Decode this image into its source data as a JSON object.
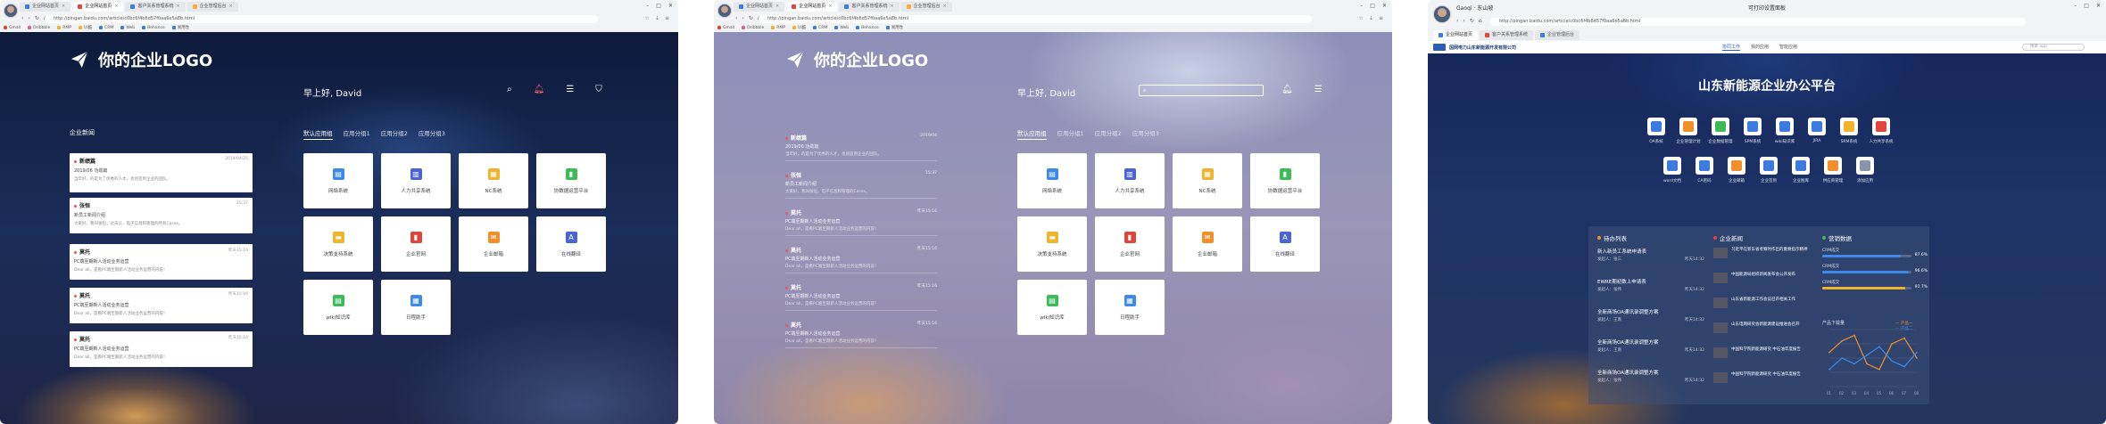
{
  "shot1": {
    "tabs": [
      {
        "label": "企业网站首页",
        "color": "#3d7be0"
      },
      {
        "label": "企业网站首页",
        "color": "#e0453d",
        "active": true
      },
      {
        "label": "客户关系管理系统",
        "color": "#3d7be0"
      },
      {
        "label": "企业管理后台",
        "color": "#f1b32b"
      }
    ],
    "address": "http://pingan.baidu.com/article/c0bc6f4b6d57f0aa6e5a8b.html",
    "bookmarks": [
      {
        "label": "Gmail",
        "color": "#e0453d"
      },
      {
        "label": "Dribbble",
        "color": "#e85d9c"
      },
      {
        "label": "RMP",
        "color": "#f1b32b"
      },
      {
        "label": "UI酷",
        "color": "#f1b32b"
      },
      {
        "label": "CRM",
        "color": "#3d7be0"
      },
      {
        "label": "Web",
        "color": "#3d7be0"
      },
      {
        "label": "Behance",
        "color": "#3d7be0"
      },
      {
        "label": "易用性",
        "color": "#3d7be0"
      }
    ],
    "logo": "你的企业LOGO",
    "greeting": "早上好, David",
    "news_title": "企业新闻",
    "news": [
      {
        "title": "新绩篇",
        "date": "2019/04/25",
        "sub": "2019/06 功勋篇",
        "body": "当年好，的是为了优秀的人才，也创造到企业的团队。"
      },
      {
        "title": "张恒",
        "date": "15:37",
        "sub": "新员工新闻介绍",
        "body": "大家好，我叫张恒，过去认，电子信息和管理的所有Cases。"
      },
      {
        "title": "莫托",
        "date": "昨天15:16",
        "sub": "PC端至期新人活动业务运营",
        "body": "Dear all，是看PC端至期新人活动业务运营的内容！"
      },
      {
        "title": "莫托",
        "date": "昨天15:16",
        "sub": "PC端至期新人活动业务运营",
        "body": "Dear all，是看PC端至期新人活动业务运营的内容！"
      },
      {
        "title": "莫托",
        "date": "昨天15:16",
        "sub": "PC端至期新人活动业务运营",
        "body": "Dear all，是看PC端至期新人活动业务运营的内容！"
      }
    ],
    "app_tabs": [
      "默认应用组",
      "应用分组1",
      "应用分组2",
      "应用分组3"
    ],
    "apps": [
      {
        "label": "网络系统",
        "color": "#3d8ae8",
        "glyph": "▤"
      },
      {
        "label": "人力共享系统",
        "color": "#4a63d6",
        "glyph": "▥"
      },
      {
        "label": "NC系统",
        "color": "#f1b32b",
        "glyph": "▦"
      },
      {
        "label": "协数据运营平台",
        "color": "#3dbb58",
        "glyph": "▮"
      },
      {
        "label": "决策支持系统",
        "color": "#f1b32b",
        "glyph": "▬"
      },
      {
        "label": "企业官网",
        "color": "#e0453d",
        "glyph": "▮"
      },
      {
        "label": "企业邮箱",
        "color": "#f18f2b",
        "glyph": "✉"
      },
      {
        "label": "在线翻译",
        "color": "#4a63d6",
        "glyph": "A"
      },
      {
        "label": "wiki知识库",
        "color": "#3dbb58",
        "glyph": "▤"
      },
      {
        "label": "日程助手",
        "color": "#3d8ae8",
        "glyph": "▦"
      }
    ]
  },
  "shot2": {
    "tabs": [
      {
        "label": "企业网站首页",
        "color": "#3d7be0"
      },
      {
        "label": "企业网站首页",
        "color": "#e0453d",
        "active": true
      },
      {
        "label": "客户关系管理系统",
        "color": "#3d7be0"
      },
      {
        "label": "企业管理后台",
        "color": "#f1b32b"
      }
    ],
    "address": "http://pingan.baidu.com/article/c0bc6f4b6d57f0aa6e5a8b.html",
    "logo": "你的企业LOGO",
    "greeting": "早上好, David",
    "news": [
      {
        "title": "新绩篇",
        "date": "2019/04",
        "sub": "2019/06 功勋篇",
        "body": "当年好，的是为了优秀的人才，也创造到企业的团队。"
      },
      {
        "title": "张恒",
        "date": "15:37",
        "sub": "新员工新闻介绍",
        "body": "大家好，我叫张恒，电子信息和管理的Cases。"
      },
      {
        "title": "莫托",
        "date": "昨天15:16",
        "sub": "PC端至期新人活动业务运营",
        "body": "Dear all，是看PC端至期新人活动业务运营的内容！"
      },
      {
        "title": "莫托",
        "date": "昨天15:16",
        "sub": "PC端至期新人活动业务运营",
        "body": "Dear all，是看PC端至期新人活动业务运营的内容！"
      },
      {
        "title": "莫托",
        "date": "昨天15:16",
        "sub": "PC端至期新人活动业务运营",
        "body": "Dear all，是看PC端至期新人活动业务运营的内容！"
      },
      {
        "title": "莫托",
        "date": "昨天15:16",
        "sub": "PC端至期新人活动业务运营",
        "body": "Dear all，是看PC端至期新人活动业务运营的内容！"
      }
    ],
    "app_tabs": [
      "默认应用组",
      "应用分组1",
      "应用分组2",
      "应用分组3"
    ]
  },
  "shot3": {
    "title": "Gaoqi · 东山坡",
    "window_title": "可打印设置面板",
    "address": "http://pingan.baidu.com/article/c0bc6f4b6d57f0aa6e5a8b.html",
    "company": "国网电力山东新能源开发有限公司",
    "top_nav": [
      "协同工作",
      "我的应用",
      "智能应用"
    ],
    "search_placeholder": "搜索 app",
    "platform_title": "山东新能源企业办公平台",
    "row1": [
      {
        "label": "OA系统",
        "color": "#3d7be0"
      },
      {
        "label": "企业管理计划",
        "color": "#f18f2b"
      },
      {
        "label": "企业数据管理",
        "color": "#3dbb58"
      },
      {
        "label": "SPM系统",
        "color": "#3d7be0"
      },
      {
        "label": "wiki知识库",
        "color": "#3d7be0"
      },
      {
        "label": "JIRA",
        "color": "#3d7be0"
      },
      {
        "label": "SRM系统",
        "color": "#f1b32b"
      },
      {
        "label": "人力共享系统",
        "color": "#e0453d"
      }
    ],
    "row2": [
      {
        "label": "word文档",
        "color": "#3d7be0"
      },
      {
        "label": "CA密码",
        "color": "#3d7be0"
      },
      {
        "label": "企业邮箱",
        "color": "#f18f2b"
      },
      {
        "label": "企业签到",
        "color": "#3d7be0"
      },
      {
        "label": "企业图库",
        "color": "#3d7be0"
      },
      {
        "label": "供应商管理",
        "color": "#f18f2b"
      },
      {
        "label": "添加应用",
        "color": "#8a93a8"
      }
    ],
    "todo_title": "待办列表",
    "news_title": "企业新闻",
    "ops_title": "营销数据",
    "todos": [
      {
        "title": "新入新员工系统申请表",
        "meta": "发起人：张三",
        "time": "昨天14:32"
      },
      {
        "title": "EWRE期初数上申请表",
        "meta": "发起人：张伟",
        "time": "昨天14:32"
      },
      {
        "title": "全新商场OA通讯录调整方案",
        "meta": "发起人：王南",
        "time": "昨天14:32"
      },
      {
        "title": "全新商场OA通讯录调整方案",
        "meta": "发起人：王南",
        "time": "昨天14:32"
      },
      {
        "title": "全新商场OA通讯录调整方案",
        "meta": "发起人：张伟",
        "time": "昨天14:32"
      }
    ],
    "news": [
      "习近平在新东省考察时作出的重要指示精神",
      "中国能源局组织新闻发布会公开发布",
      "山东省新能源工作会议召开相关工作",
      "山东电网研究会新能源建设推进会召开",
      "中国科学院新能源研究 中石油年度报告",
      "中国科学院新能源研究 中石油年度报告"
    ],
    "ops": [
      {
        "label": "CRM成交",
        "value": "87.6%",
        "pct": 87.6,
        "color": "#3d8ae8"
      },
      {
        "label": "CRM成交",
        "value": "96.6%",
        "pct": 96.6,
        "color": "#3d8ae8"
      },
      {
        "label": "CRM成交",
        "value": "92.7%",
        "pct": 92.7,
        "color": "#f1b32b"
      }
    ],
    "chart_data": {
      "type": "line",
      "title": "产品下载量",
      "x": [
        "01",
        "02",
        "03",
        "04",
        "05",
        "06",
        "07",
        "08"
      ],
      "series": [
        {
          "name": "产品一",
          "color": "#f18f2b",
          "values": [
            60,
            80,
            90,
            40,
            30,
            75,
            85,
            50
          ]
        },
        {
          "name": "产品二",
          "color": "#3d8ae8",
          "values": [
            30,
            50,
            40,
            55,
            70,
            45,
            35,
            60
          ]
        }
      ],
      "ylim": [
        0,
        100
      ]
    }
  }
}
